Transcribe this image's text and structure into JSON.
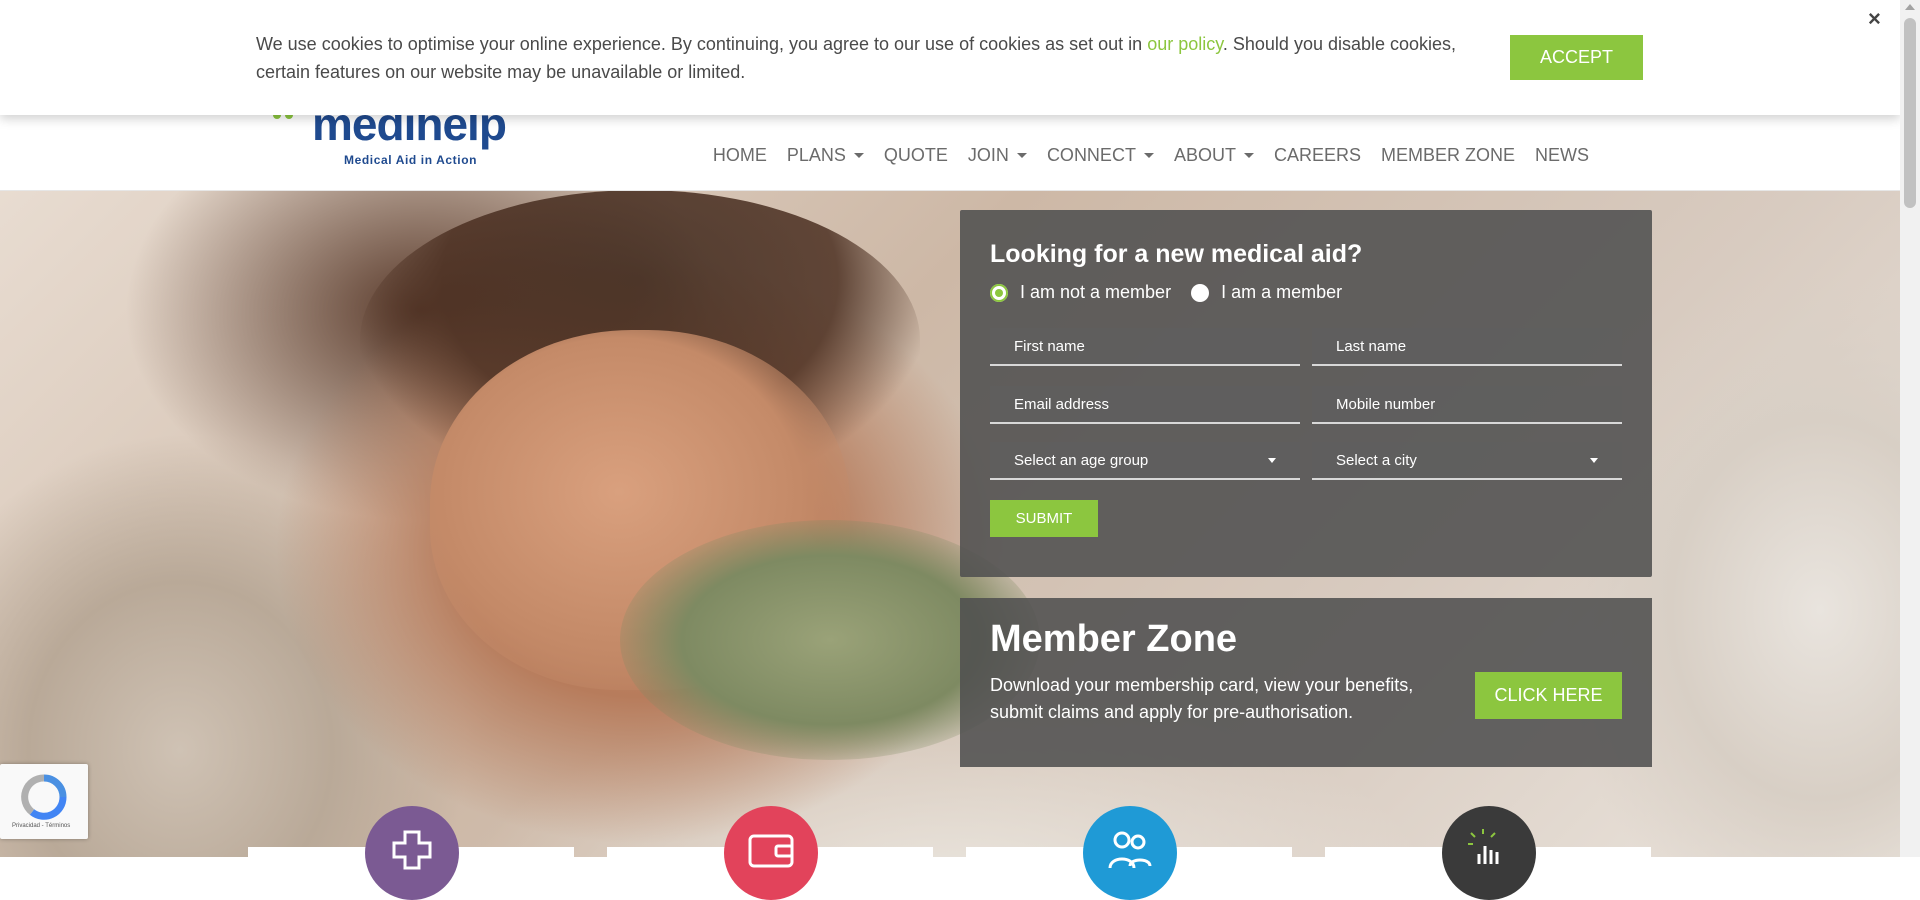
{
  "cookie_banner": {
    "text_before_link": "We use cookies to optimise your online experience. By continuing, you agree to our use of cookies as set out in ",
    "link_text": "our policy",
    "text_after_link": ". Should you disable cookies, certain features on our website may be unavailable or limited.",
    "accept_label": "ACCEPT",
    "close_label": "×"
  },
  "brand": {
    "logo_word": "medihelp",
    "tagline": "Medical Aid in Action",
    "brand_color": "#1f4a8f",
    "accent_color": "#8cc63f"
  },
  "nav": {
    "items": [
      {
        "label": "HOME",
        "dropdown": false
      },
      {
        "label": "PLANS",
        "dropdown": true
      },
      {
        "label": "QUOTE",
        "dropdown": false
      },
      {
        "label": "JOIN",
        "dropdown": true
      },
      {
        "label": "CONNECT",
        "dropdown": true
      },
      {
        "label": "ABOUT",
        "dropdown": true
      },
      {
        "label": "CAREERS",
        "dropdown": false
      },
      {
        "label": "MEMBER ZONE",
        "dropdown": false
      },
      {
        "label": "NEWS",
        "dropdown": false
      }
    ]
  },
  "lead_form": {
    "title": "Looking for a new medical aid?",
    "radio_not_member": "I am not a member",
    "radio_member": "I am a member",
    "selected": "not_member",
    "first_name_placeholder": "First name",
    "last_name_placeholder": "Last name",
    "email_placeholder": "Email address",
    "mobile_placeholder": "Mobile number",
    "age_group_select": "Select an age group",
    "city_select": "Select a city",
    "submit_label": "SUBMIT"
  },
  "member_zone": {
    "title": "Member Zone",
    "description": "Download your membership card, view your benefits, submit claims and apply for pre-authorisation.",
    "button_label": "CLICK HERE"
  },
  "feature_icons": [
    {
      "icon": "medical-cross-icon",
      "color": "#7b5a93"
    },
    {
      "icon": "wallet-icon",
      "color": "#e2435b"
    },
    {
      "icon": "people-icon",
      "color": "#1f9ad6"
    },
    {
      "icon": "hand-pointer-icon",
      "color": "#3a3a3a"
    }
  ],
  "recaptcha": {
    "text": "Privacidad - Términos"
  }
}
